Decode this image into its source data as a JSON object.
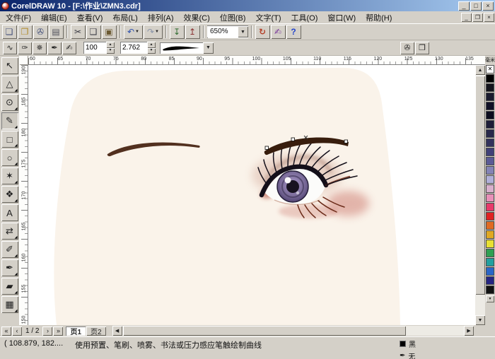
{
  "colors": {
    "chrome": "#D4D0C8",
    "title1": "#0A246A",
    "title2": "#A6CAF0",
    "ruler_bg": "#FDFDFB",
    "canvas_bg": "#FFFFFF"
  },
  "artwork": {
    "face": "#FAF3EA",
    "brow_left": "#52301F",
    "brow_right": "#381D0D",
    "iris_inner": "#A695C6",
    "iris_mid": "#7A6B99",
    "iris_outer": "#4E4170",
    "pupil": "#17121F",
    "lash": "#140F19",
    "lower_lash": "#6B2A18",
    "shadow_warm": "#C89280",
    "blush": "#C25F52",
    "crease": "#8A5A48",
    "inner_corner": "#B0402E",
    "waterline": "#C9A08E",
    "sclera": "#FCFCFA"
  },
  "window": {
    "title": "CorelDRAW 10 - [F:\\作业\\ZMN3.cdr]",
    "minimize_glyph": "_",
    "maximize_glyph": "□",
    "close_glyph": "×",
    "doc_minimize_glyph": "_",
    "doc_restore_glyph": "❐",
    "doc_close_glyph": "×"
  },
  "menu": {
    "items": [
      "文件(F)",
      "编辑(E)",
      "查看(V)",
      "布局(L)",
      "排列(A)",
      "效果(C)",
      "位图(B)",
      "文字(T)",
      "工具(O)",
      "窗口(W)",
      "帮助(H)"
    ]
  },
  "glyphs": {
    "dropdown": "▼",
    "up": "▲",
    "down": "▼",
    "left": "◀",
    "right": "▶",
    "spin_up": "▲",
    "spin_down": "▼",
    "no_color": "✕"
  },
  "toolbar": {
    "group_file": [
      {
        "name": "new-button",
        "glyph": "❏",
        "color": "#44507a"
      },
      {
        "name": "open-button",
        "glyph": "❐",
        "color": "#b08a28"
      },
      {
        "name": "save-button",
        "glyph": "✇",
        "color": "#44507a"
      },
      {
        "name": "print-button",
        "glyph": "▤",
        "color": "#50505a"
      }
    ],
    "group_clipboard": [
      {
        "name": "cut-button",
        "glyph": "✂",
        "color": "#3a3a44"
      },
      {
        "name": "copy-button",
        "glyph": "❑",
        "color": "#3a3a44"
      },
      {
        "name": "paste-button",
        "glyph": "▣",
        "color": "#6b5a33"
      }
    ],
    "group_undo": [
      {
        "name": "undo-button",
        "glyph": "↶",
        "color": "#2b4fae",
        "arrow": "▼"
      },
      {
        "name": "redo-button",
        "glyph": "↷",
        "color": "#8a94a8",
        "arrow": "▼"
      }
    ],
    "group_io": [
      {
        "name": "import-button",
        "glyph": "↧",
        "color": "#2f6b2f"
      },
      {
        "name": "export-button",
        "glyph": "↥",
        "color": "#8a2f2f"
      }
    ],
    "zoom_value": "650%",
    "group_misc": [
      {
        "name": "refresh-button",
        "glyph": "↻",
        "color": "#b4412a"
      },
      {
        "name": "launcher-button",
        "glyph": "✍",
        "color": "#7a3a9a"
      },
      {
        "name": "help-button",
        "glyph": "?",
        "color": "#2244cc"
      }
    ]
  },
  "property_bar": {
    "modes": [
      {
        "name": "preset-mode-button",
        "glyph": "∿"
      },
      {
        "name": "brush-mode-button",
        "glyph": "✑"
      },
      {
        "name": "sprayer-mode-button",
        "glyph": "✵"
      },
      {
        "name": "calligraphic-mode-button",
        "glyph": "✒"
      },
      {
        "name": "pressure-mode-button",
        "glyph": "✍"
      }
    ],
    "smoothing_value": "100",
    "width_value": "2.762",
    "right_buttons": [
      {
        "name": "save-artistic-media-button",
        "glyph": "✇"
      },
      {
        "name": "browse-strokes-button",
        "glyph": "❐"
      }
    ]
  },
  "rulers": {
    "unit": "毫米",
    "h_numbers": [
      "60",
      "65",
      "70",
      "75",
      "80",
      "85",
      "90",
      "95",
      "100",
      "105",
      "110",
      "115",
      "120",
      "125",
      "130",
      "135"
    ],
    "v_numbers": [
      "190",
      "185",
      "180",
      "175",
      "170",
      "165",
      "160",
      "155",
      "150"
    ]
  },
  "toolbox": {
    "tools": [
      {
        "name": "pick-tool",
        "glyph": "↖"
      },
      {
        "name": "shape-tool",
        "glyph": "△",
        "fly": "◢"
      },
      {
        "name": "zoom-tool",
        "glyph": "⊙",
        "fly": "◢"
      },
      {
        "name": "freehand-artistic-media-tool",
        "glyph": "✎",
        "fly": "◢",
        "pressed": true
      },
      {
        "name": "rectangle-tool",
        "glyph": "□",
        "fly": "◢"
      },
      {
        "name": "ellipse-tool",
        "glyph": "○",
        "fly": "◢"
      },
      {
        "name": "polygon-tool",
        "glyph": "✶",
        "fly": "◢"
      },
      {
        "name": "basic-shapes-tool",
        "glyph": "❖",
        "fly": "◢"
      },
      {
        "name": "text-tool",
        "glyph": "A"
      },
      {
        "name": "interactive-blend-tool",
        "glyph": "⇄",
        "fly": "◢"
      },
      {
        "name": "eyedropper-tool",
        "glyph": "✐",
        "fly": "◢"
      },
      {
        "name": "outline-tool",
        "glyph": "✒",
        "fly": "◢"
      },
      {
        "name": "fill-tool",
        "glyph": "▰",
        "fly": "◢"
      },
      {
        "name": "interactive-fill-tool",
        "glyph": "▦",
        "fly": "◢"
      }
    ]
  },
  "palette": {
    "colors": [
      "#000000",
      "#14141c",
      "#1a1a2e",
      "#101026",
      "#0c0c1e",
      "#1e1e38",
      "#28284a",
      "#32325c",
      "#404078",
      "#5a5a96",
      "#8484b6",
      "#b0b0d8",
      "#d8b0cc",
      "#e890b8",
      "#e83a6a",
      "#e02222",
      "#e06a22",
      "#e0a822",
      "#e8e032",
      "#2ea052",
      "#22a0a0",
      "#2a66c8",
      "#252582",
      "#111111"
    ]
  },
  "pages": {
    "counter": "1 / 2",
    "nav_back": [
      {
        "name": "first-page-button",
        "glyph": "«"
      },
      {
        "name": "prev-page-button",
        "glyph": "‹"
      }
    ],
    "nav_fwd": [
      {
        "name": "next-page-button",
        "glyph": "›"
      },
      {
        "name": "last-page-button",
        "glyph": "»"
      }
    ],
    "tabs": [
      {
        "name": "page-tab-1",
        "label": "页1",
        "pressed": true
      },
      {
        "name": "page-tab-2",
        "label": "页2"
      }
    ]
  },
  "statusbar": {
    "coords": "( 108.879, 182....",
    "hint": "使用预置、笔刷、喷雾、书法或压力感应笔触绘制曲线",
    "fill_label": "黑",
    "outline_label": "无"
  }
}
